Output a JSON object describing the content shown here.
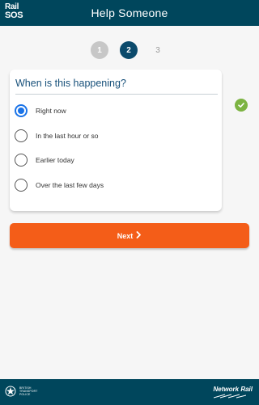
{
  "header": {
    "logo_line1": "Rail",
    "logo_line2": "SOS",
    "title": "Help Someone"
  },
  "steps": {
    "items": [
      {
        "label": "1",
        "state": "completed"
      },
      {
        "label": "2",
        "state": "current"
      },
      {
        "label": "3",
        "state": "upcoming"
      }
    ]
  },
  "question": {
    "title": "When is this happening?",
    "selected_index": 0,
    "options": [
      {
        "label": "Right now"
      },
      {
        "label": "In the last hour or so"
      },
      {
        "label": "Earlier today"
      },
      {
        "label": "Over the last few days"
      }
    ]
  },
  "status_icon": "check-circle-icon",
  "next_button": {
    "label": "Next",
    "icon": "chevron-right-icon"
  },
  "footer": {
    "left_logo_lines": [
      "BRITISH",
      "TRANSPORT",
      "POLICE"
    ],
    "right_logo": "Network Rail"
  },
  "colors": {
    "header_bg": "#00465c",
    "step_current": "#0b4a6b",
    "step_completed": "#c7c7c7",
    "radio_selected": "#1a73e8",
    "accent_button": "#f45d18",
    "check_green": "#7cb342"
  }
}
